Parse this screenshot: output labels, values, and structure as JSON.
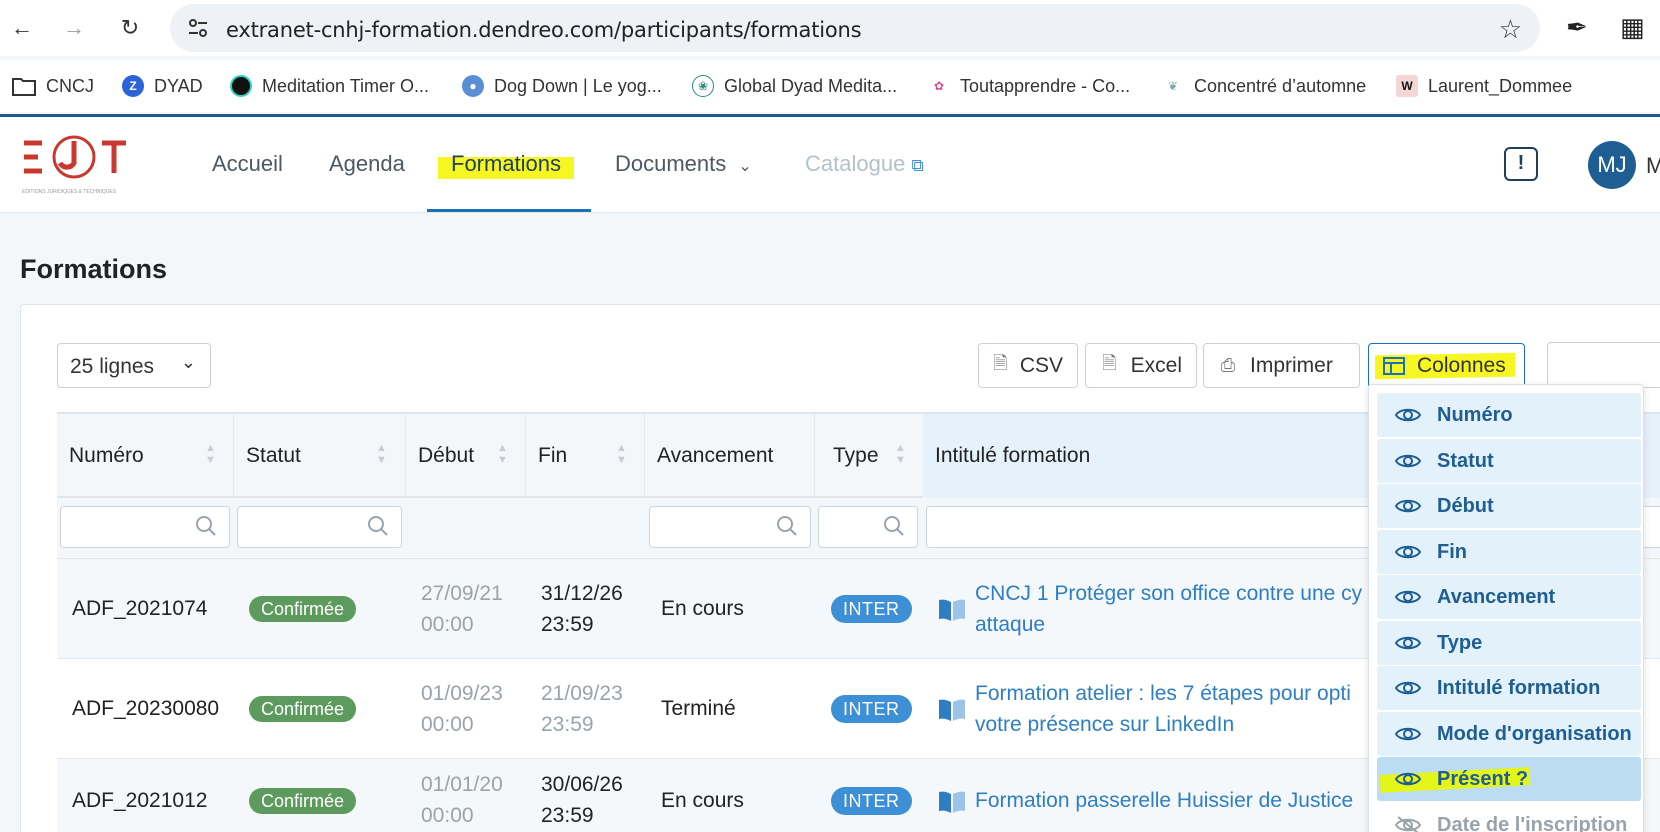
{
  "browser": {
    "url": "extranet-cnhj-formation.dendreo.com/participants/formations",
    "bookmarks": [
      {
        "label": "CNCJ",
        "icon": "folder-icon"
      },
      {
        "label": "DYAD",
        "icon": "dyad-icon"
      },
      {
        "label": "Meditation Timer O...",
        "icon": "timer-icon"
      },
      {
        "label": "Dog Down | Le yog...",
        "icon": "dog-icon"
      },
      {
        "label": "Global Dyad Medita...",
        "icon": "lotus-icon"
      },
      {
        "label": "Toutapprendre - Co...",
        "icon": "flower-icon"
      },
      {
        "label": "Concentré d’automne",
        "icon": "leaf-icon"
      },
      {
        "label": "Laurent_Dommee",
        "icon": "w-icon"
      }
    ]
  },
  "header": {
    "nav": [
      {
        "label": "Accueil"
      },
      {
        "label": "Agenda"
      },
      {
        "label": "Formations"
      },
      {
        "label": "Documents"
      },
      {
        "label": "Catalogue"
      }
    ],
    "avatar_initials": "MJ",
    "user_initial": "M"
  },
  "page": {
    "title": "Formations"
  },
  "toolbar": {
    "lines": "25 lignes",
    "csv": "CSV",
    "excel": "Excel",
    "print": "Imprimer",
    "columns": "Colonnes"
  },
  "table": {
    "headers": [
      "Numéro",
      "Statut",
      "Début",
      "Fin",
      "Avancement",
      "Type",
      "Intitulé formation"
    ],
    "rows": [
      {
        "numero": "ADF_2021074",
        "statut": "Confirmée",
        "debut_date": "27/09/21",
        "debut_time": "00:00",
        "fin_date": "31/12/26",
        "fin_time": "23:59",
        "avancement": "En cours",
        "type": "INTER",
        "intitule_1": "CNCJ 1 Protéger son office contre une cy",
        "intitule_2": "attaque"
      },
      {
        "numero": "ADF_20230080",
        "statut": "Confirmée",
        "debut_date": "01/09/23",
        "debut_time": "00:00",
        "fin_date": "21/09/23",
        "fin_time": "23:59",
        "avancement": "Terminé",
        "type": "INTER",
        "intitule_1": "Formation atelier : les 7 étapes pour opti",
        "intitule_2": "votre présence sur LinkedIn"
      },
      {
        "numero": "ADF_2021012",
        "statut": "Confirmée",
        "debut_date": "01/01/20",
        "debut_time": "00:00",
        "fin_date": "30/06/26",
        "fin_time": "23:59",
        "avancement": "En cours",
        "type": "INTER",
        "intitule_1": "Formation passerelle Huissier de Justice",
        "intitule_2": ""
      }
    ]
  },
  "columns_menu": {
    "items": [
      {
        "label": "Numéro"
      },
      {
        "label": "Statut"
      },
      {
        "label": "Début"
      },
      {
        "label": "Fin"
      },
      {
        "label": "Avancement"
      },
      {
        "label": "Type"
      },
      {
        "label": "Intitulé formation"
      },
      {
        "label": "Mode d'organisation"
      },
      {
        "label": "Présent ?"
      },
      {
        "label": "Date de l'inscription"
      }
    ]
  },
  "colors": {
    "accent": "#1d6fb8",
    "badge_confirmed": "#5d9a5d",
    "badge_inter": "#3d8fd6",
    "highlight": "#f6f622"
  }
}
